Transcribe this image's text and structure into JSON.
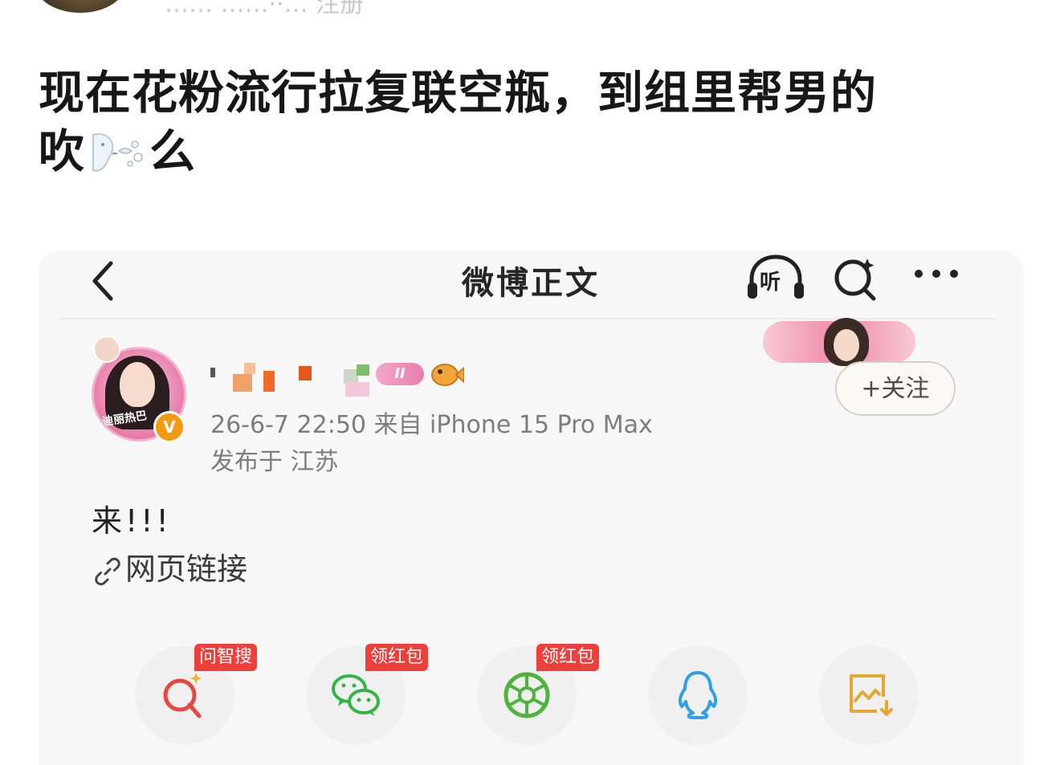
{
  "header": {
    "name_partial": "…… ……··… 注册"
  },
  "post": {
    "text_line1": "现在花粉流行拉复联空瓶，到组里帮男的",
    "text_line2_start": "吹",
    "text_line2_end": "么",
    "emoji_icon": "blowing-face-icon"
  },
  "screenshot": {
    "nav": {
      "title": "微博正文",
      "listen_label": "听"
    },
    "user": {
      "avatar_caption": "迪丽热巴",
      "verified_mark": "V",
      "level_badge": "II",
      "meta": "26-6-7 22:50  来自 iPhone 15 Pro Max",
      "location": "发布于 江苏",
      "follow_label": "+关注"
    },
    "content": {
      "text": "来!!!",
      "link_label": "网页链接"
    },
    "share": [
      {
        "name": "ask-search",
        "badge": "问智搜",
        "icon": "magnifier-sparkle-icon",
        "color": "#e8463e"
      },
      {
        "name": "wechat",
        "badge": "领红包",
        "icon": "wechat-icon",
        "color": "#32b447"
      },
      {
        "name": "moments",
        "badge": "领红包",
        "icon": "moments-icon",
        "color": "#4db33d"
      },
      {
        "name": "qq",
        "badge": "",
        "icon": "qq-penguin-icon",
        "color": "#2f9fe8"
      },
      {
        "name": "save-image",
        "badge": "",
        "icon": "save-image-icon",
        "color": "#e2a832"
      }
    ]
  }
}
